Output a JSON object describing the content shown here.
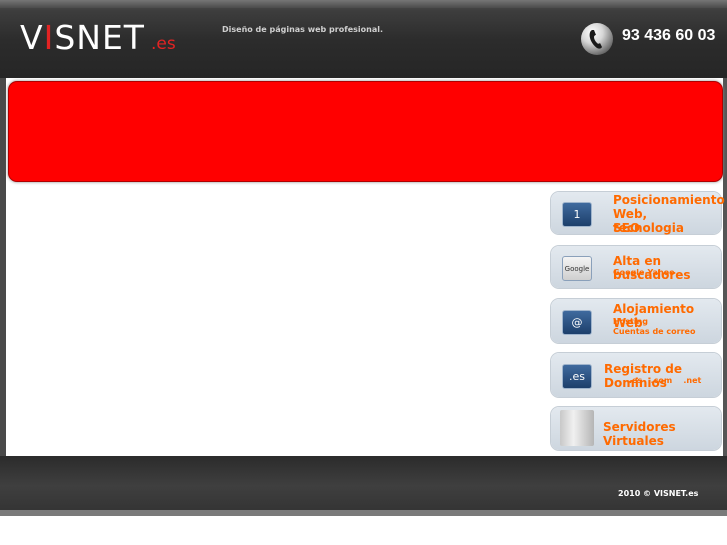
{
  "header": {
    "logo_main": "VISNET",
    "logo_v": "V",
    "logo_i": "I",
    "logo_rest": "SNET",
    "logo_ext": ".es",
    "tagline": "Diseño de páginas web profesional.",
    "phone_icon": "phone-icon",
    "phone": "93 436 60 03"
  },
  "banner": {
    "color": "#ff0000"
  },
  "services": [
    {
      "icon": "rank-1-icon",
      "icon_text": "1",
      "title_lines": [
        "Posicionamiento",
        "Web,  tecnologia",
        "SEO"
      ],
      "subs": []
    },
    {
      "icon": "google-icon",
      "icon_text": "Google",
      "title_lines": [
        "Alta en buscadores"
      ],
      "subs": [
        "Google,Yahoo"
      ]
    },
    {
      "icon": "at-sign-icon",
      "icon_text": "@",
      "title_lines": [
        "Alojamiento Web"
      ],
      "subs": [
        "Hosting",
        "Cuentas de correo"
      ]
    },
    {
      "icon": "domain-es-icon",
      "icon_text": ".es",
      "title_lines": [
        "Registro de Dominios"
      ],
      "subs": [
        ".es   .com    .net"
      ]
    },
    {
      "icon": "server-icon",
      "icon_text": "",
      "title_lines": [
        "Servidores Virtuales"
      ],
      "subs": []
    }
  ],
  "footer": {
    "copyright": "2010 © VISNET.es"
  },
  "colors": {
    "accent": "#ff6a00",
    "banner": "#ff0000",
    "logo_red": "#e32323"
  }
}
